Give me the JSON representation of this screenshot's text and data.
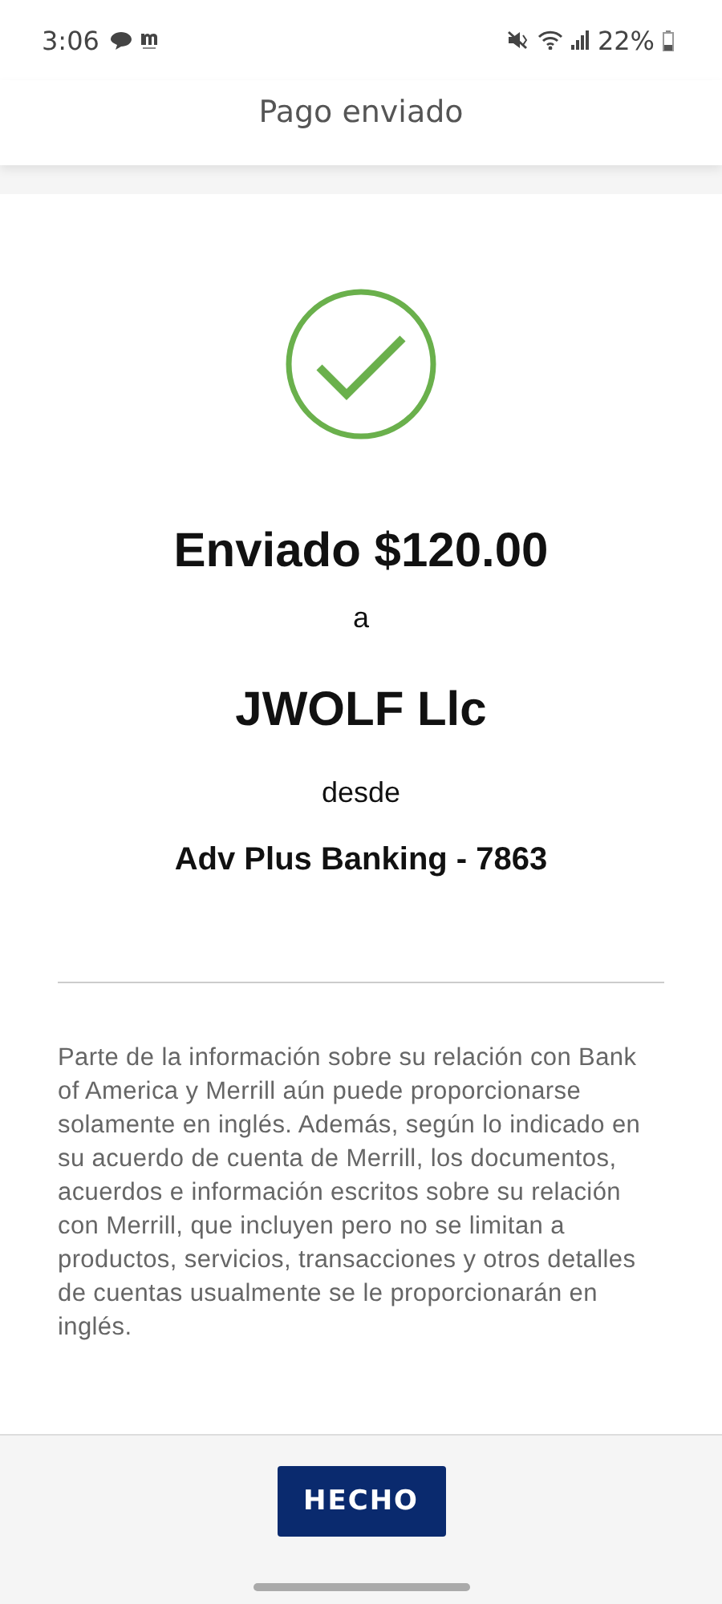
{
  "status_bar": {
    "time": "3:06",
    "battery": "22%"
  },
  "header": {
    "title": "Pago enviado"
  },
  "confirmation": {
    "amount_line": "Enviado $120.00",
    "to_word": "a",
    "payee": "JWOLF Llc",
    "from_word": "desde",
    "account": "Adv Plus Banking - 7863"
  },
  "disclaimer": "Parte de la información sobre su relación con Bank of America y Merrill aún puede proporcionarse solamente en inglés. Además, según lo indicado en su acuerdo de cuenta de Merrill, los documentos, acuerdos e información escritos sobre su relación con Merrill, que incluyen pero no se limitan a productos, servicios, transacciones y otros detalles de cuentas usualmente se le proporcionarán en inglés.",
  "footer": {
    "button": "HECHO"
  }
}
